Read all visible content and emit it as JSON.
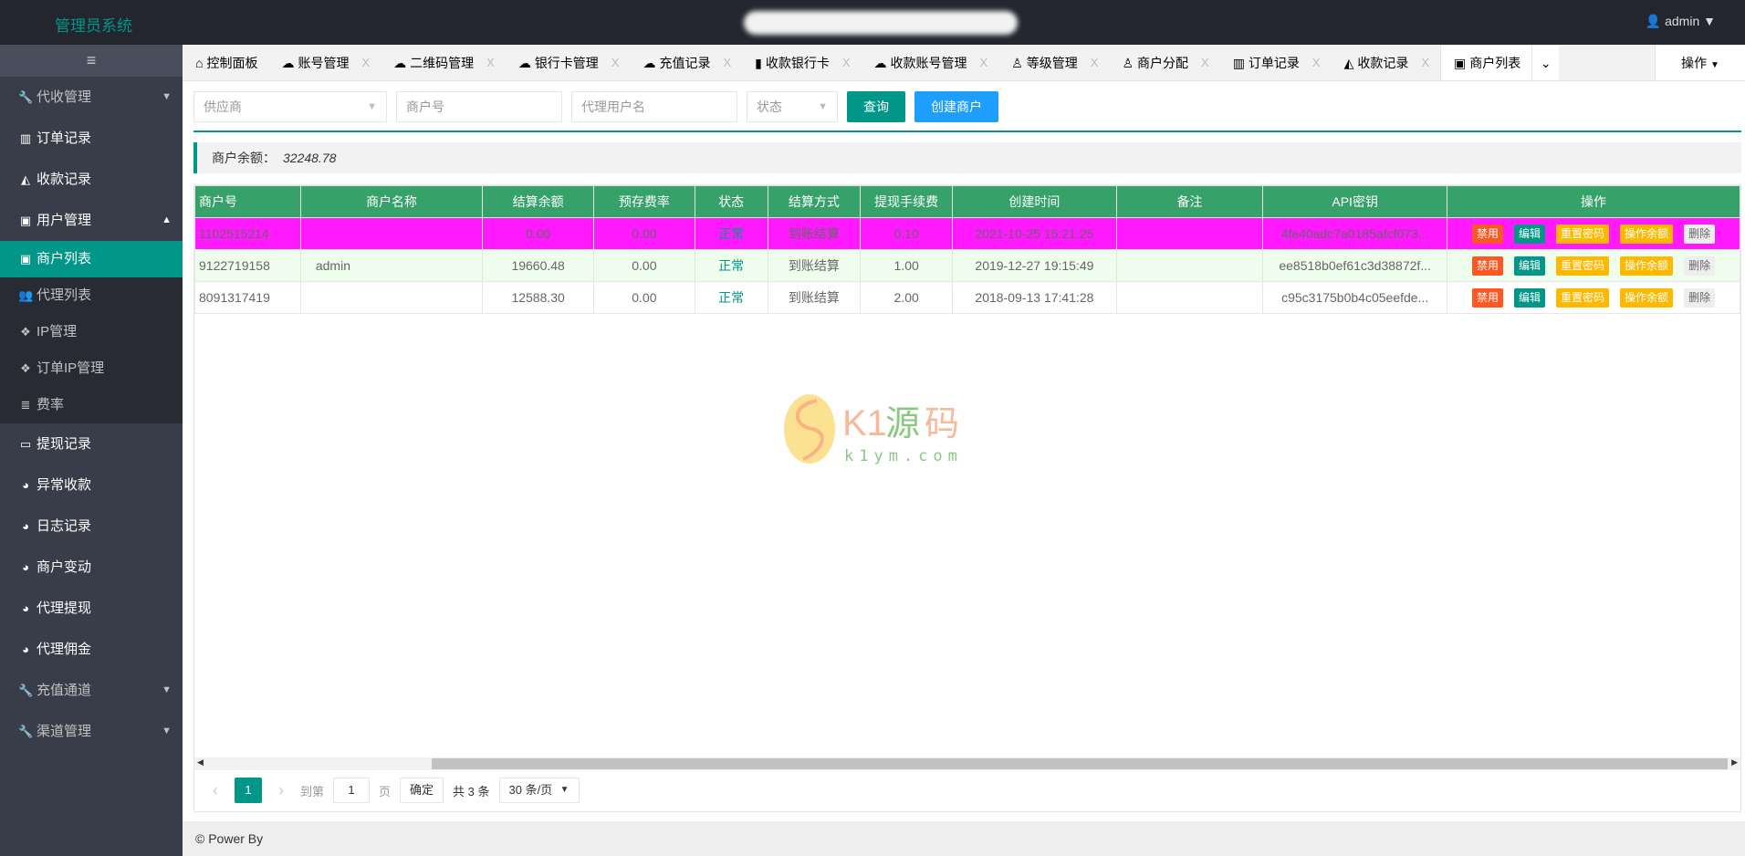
{
  "header": {
    "title": "管理员系统",
    "user": "admin"
  },
  "sidebar": {
    "toggle": "≡",
    "items": [
      {
        "label": "代收管理"
      },
      {
        "label": "订单记录"
      },
      {
        "label": "收款记录"
      },
      {
        "label": "用户管理"
      },
      {
        "label": "商户列表"
      },
      {
        "label": "代理列表"
      },
      {
        "label": "IP管理"
      },
      {
        "label": "订单IP管理"
      },
      {
        "label": "费率"
      },
      {
        "label": "提现记录"
      },
      {
        "label": "异常收款"
      },
      {
        "label": "日志记录"
      },
      {
        "label": "商户变动"
      },
      {
        "label": "代理提现"
      },
      {
        "label": "代理佣金"
      },
      {
        "label": "充值通道"
      },
      {
        "label": "渠道管理"
      }
    ]
  },
  "tabs": [
    {
      "label": "控制面板"
    },
    {
      "label": "账号管理"
    },
    {
      "label": "二维码管理"
    },
    {
      "label": "银行卡管理"
    },
    {
      "label": "充值记录"
    },
    {
      "label": "收款银行卡"
    },
    {
      "label": "收款账号管理"
    },
    {
      "label": "等级管理"
    },
    {
      "label": "商户分配"
    },
    {
      "label": "订单记录"
    },
    {
      "label": "收款记录"
    },
    {
      "label": "商户列表"
    }
  ],
  "tab_close": "X",
  "tab_ops": "操作",
  "filters": {
    "supplier": "供应商",
    "merchant_no": "商户号",
    "agent_user": "代理用户名",
    "status": "状态",
    "query": "查询",
    "create": "创建商户"
  },
  "balance": {
    "label": "商户余额：",
    "value": "32248.78"
  },
  "table": {
    "columns": [
      "商户号",
      "商户名称",
      "结算余额",
      "预存费率",
      "状态",
      "结算方式",
      "提现手续费",
      "创建时间",
      "备注",
      "API密钥",
      "操作"
    ],
    "rows": [
      [
        "1102515214",
        "",
        "0.00",
        "0.00",
        "正常",
        "到账结算",
        "0.10",
        "2021-10-25 15:21:25",
        "",
        "4fe40adc7a0185afcf073..."
      ],
      [
        "9122719158",
        "admin",
        "19660.48",
        "0.00",
        "正常",
        "到账结算",
        "1.00",
        "2019-12-27 19:15:49",
        "",
        "ee8518b0ef61c3d38872f..."
      ],
      [
        "8091317419",
        "",
        "12588.30",
        "0.00",
        "正常",
        "到账结算",
        "2.00",
        "2018-09-13 17:41:28",
        "",
        "c95c3175b0b4c05eefde..."
      ]
    ],
    "actions": [
      "禁用",
      "编辑",
      "重置密码",
      "操作余额",
      "删除"
    ]
  },
  "pager": {
    "current": "1",
    "goto": "到第",
    "page_value": "1",
    "page_unit": "页",
    "confirm": "确定",
    "total": "共 3 条",
    "per_page": "30 条/页"
  },
  "footer": "© Power By",
  "watermark": {
    "brand": "K1源码",
    "url": "k1ym.com"
  },
  "colors": {
    "accent": "#009688",
    "header_bg": "#23262e",
    "sidebar_bg": "#393d49",
    "table_header": "#36a26a",
    "highlight_row": "#ff19ff",
    "blue": "#1e9fff",
    "danger": "#ff5722",
    "warn": "#ffb800"
  }
}
